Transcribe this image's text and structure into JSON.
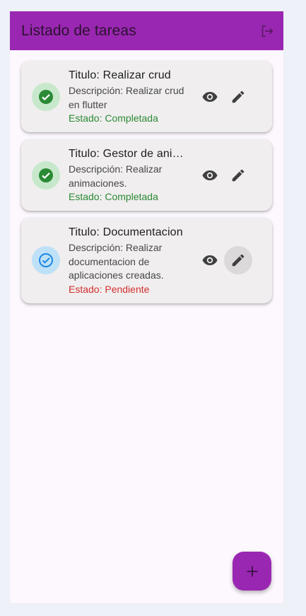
{
  "appbar": {
    "title": "Listado de tareas",
    "logout_icon": "logout-icon"
  },
  "tasks": [
    {
      "title": "Titulo: Realizar crud",
      "description": "Descripción: Realizar crud en flutter",
      "state": "Estado: Completada",
      "status": "completed"
    },
    {
      "title": "Titulo: Gestor de ani…",
      "description": "Descripción: Realizar animaciones.",
      "state": "Estado: Completada",
      "status": "completed"
    },
    {
      "title": "Titulo: Documentacion",
      "description": "Descripción: Realizar documentacion de aplicaciones creadas.",
      "state": "Estado: Pendiente",
      "status": "pending"
    }
  ],
  "icons": {
    "completed": "check-circle-icon",
    "pending": "check-circle-outline-icon",
    "view": "eye-icon",
    "edit": "pencil-icon",
    "add": "plus-icon"
  },
  "colors": {
    "primary": "#9a27b1",
    "completed": "#2b8a35",
    "pending": "#d32f2f",
    "pending_icon": "#1e88e5"
  }
}
